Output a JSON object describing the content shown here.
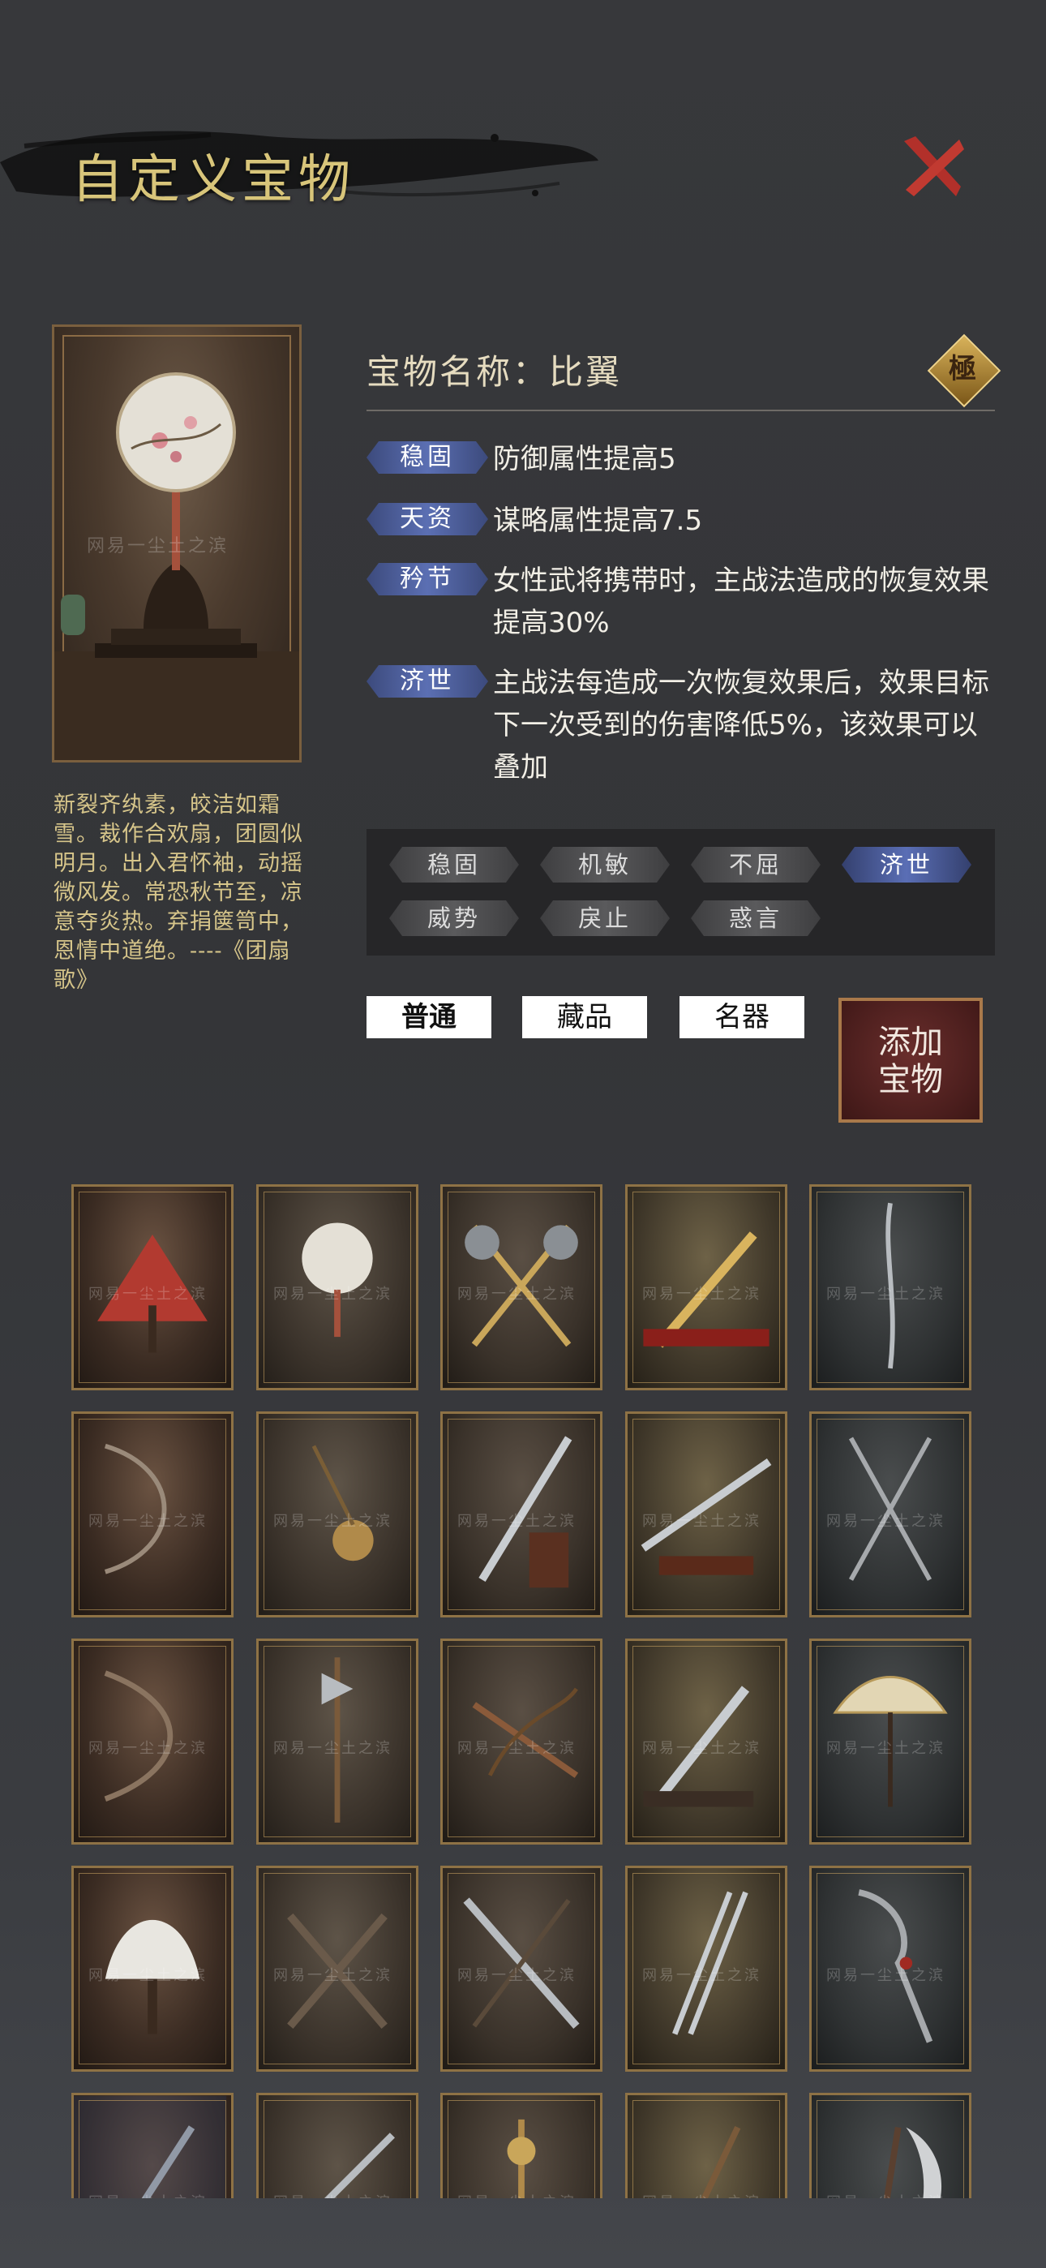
{
  "header": {
    "title": "自定义宝物",
    "close_icon": "close-x-icon",
    "close_color": "#c0392b"
  },
  "preview": {
    "watermark": "网易一尘土之滨",
    "item_icon": "round-silk-fan"
  },
  "poem": "新裂齐纨素，皎洁如霜雪。裁作合欢扇，团圆似明月。出入君怀袖，动摇微风发。常恐秋节至，凉意夺炎热。弃捐箧笥中，恩情中道绝。----《团扇歌》",
  "treasure": {
    "name_label": "宝物名称：",
    "name": "比翼",
    "grade": "極",
    "attributes": [
      {
        "tag": "稳固",
        "text": "防御属性提高5"
      },
      {
        "tag": "天资",
        "text": "谋略属性提高7.5"
      },
      {
        "tag": "矜节",
        "text": "女性武将携带时，主战法造成的恢复效果提高30%"
      },
      {
        "tag": "济世",
        "text": "主战法每造成一次恢复效果后，效果目标下一次受到的伤害降低5%，该效果可以叠加"
      }
    ]
  },
  "tag_options": [
    {
      "label": "稳固",
      "active": false
    },
    {
      "label": "机敏",
      "active": false
    },
    {
      "label": "不屈",
      "active": false
    },
    {
      "label": "济世",
      "active": true
    },
    {
      "label": "威势",
      "active": false
    },
    {
      "label": "戾止",
      "active": false
    },
    {
      "label": "惑言",
      "active": false
    }
  ],
  "quality_options": [
    {
      "label": "普通",
      "selected": true
    },
    {
      "label": "藏品",
      "selected": false
    },
    {
      "label": "名器",
      "selected": false
    }
  ],
  "add_button": {
    "line1": "添加",
    "line2": "宝物"
  },
  "grid_items": [
    "red-folding-fan",
    "round-silk-fan",
    "crossed-axes",
    "golden-sword",
    "serpent-spear",
    "long-bow",
    "meteor-hammer",
    "dao-saber",
    "curved-blade",
    "crossed-halberds",
    "recurve-bow",
    "halberd-on-stand",
    "crossbow",
    "short-dagger",
    "paper-fan-on-stand",
    "feather-fan",
    "crossed-maces",
    "jian-sword",
    "twin-swords",
    "guandao",
    "blue-sword",
    "dragon-sword",
    "ornate-dagger",
    "broad-axe",
    "moon-axe"
  ]
}
